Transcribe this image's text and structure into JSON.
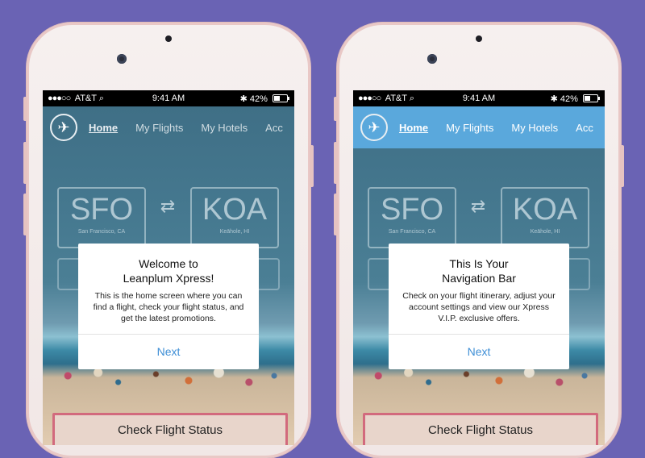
{
  "status_bar": {
    "carrier": "AT&T",
    "signal_dots": "●●●○○",
    "time": "9:41 AM",
    "battery": "42%"
  },
  "nav": {
    "items": [
      "Home",
      "My Flights",
      "My Hotels",
      "Acc"
    ]
  },
  "route": {
    "from_code": "SFO",
    "from_city": "San Francisco, CA",
    "to_code": "KOA",
    "to_city": "Keāhole, HI",
    "swap_glyph": "⇄"
  },
  "left_dialog": {
    "title_line1": "Welcome to",
    "title_line2": "Leanplum Xpress!",
    "body": "This is the home screen where you can find a flight, check your flight status, and get the latest promotions.",
    "button": "Next"
  },
  "right_dialog": {
    "title_line1": "This Is Your",
    "title_line2": "Navigation Bar",
    "body": "Check on your flight itinerary, adjust your account settings and view our Xpress V.I.P. exclusive offers.",
    "button": "Next"
  },
  "cta": {
    "label": "Check Flight Status"
  },
  "colors": {
    "background": "#6a63b4",
    "nav_highlight": "#5aa8dc",
    "link_blue": "#3f8fd6",
    "cta_border": "#d26a7d"
  }
}
